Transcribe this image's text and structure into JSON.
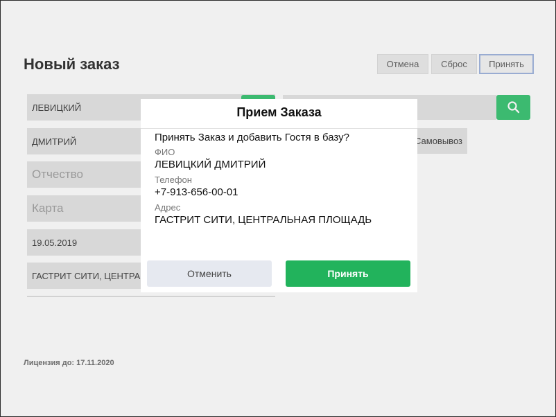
{
  "page": {
    "title": "Новый заказ",
    "license": "Лицензия до: 17.11.2020"
  },
  "toolbar": {
    "cancel_label": "Отмена",
    "reset_label": "Сброс",
    "accept_label": "Принять"
  },
  "form": {
    "last_name": "ЛЕВИЦКИЙ",
    "first_name": "ДМИТРИЙ",
    "middle_name_placeholder": "Отчество",
    "card_placeholder": "Карта",
    "date": "19.05.2019",
    "address": "ГАСТРИТ СИТИ, ЦЕНТРА",
    "pickup_label": "Самовывоз"
  },
  "icons": {
    "search": "search-icon"
  },
  "colors": {
    "accent_green": "#22b35c",
    "cancel_gray": "#e6e9f0"
  },
  "modal": {
    "title": "Прием Заказа",
    "question": "Принять Заказ и добавить Гостя в базу?",
    "fio_label": "ФИО",
    "fio_value": "ЛЕВИЦКИЙ ДМИТРИЙ",
    "phone_label": "Телефон",
    "phone_value": "+7-913-656-00-01",
    "address_label": "Адрес",
    "address_value": "ГАСТРИТ СИТИ, ЦЕНТРАЛЬНАЯ ПЛОЩАДЬ",
    "cancel_label": "Отменить",
    "accept_label": "Принять"
  }
}
